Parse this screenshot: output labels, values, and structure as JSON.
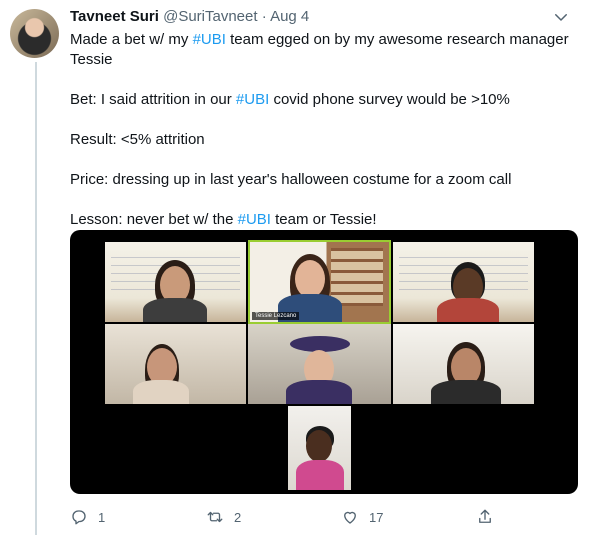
{
  "tweet": {
    "author_name": "Tavneet Suri",
    "handle": "@SuriTavneet",
    "separator": "·",
    "date": "Aug 4",
    "lines": {
      "l1_pre": "Made a bet w/ my ",
      "l1_tag": "#UBI",
      "l1_post": " team egged on by my awesome research manager Tessie",
      "l2_pre": "Bet: I said attrition in our ",
      "l2_tag": "#UBI",
      "l2_post": " covid phone survey would be >10%",
      "l3": "Result: <5% attrition",
      "l4": "Price: dressing up in last year's halloween costume for a zoom call",
      "l5_pre": "Lesson: never bet w/ the ",
      "l5_tag": "#UBI",
      "l5_post": " team or Tessie!"
    },
    "media": {
      "nametag": "Tessie Lezcano"
    },
    "actions": {
      "reply_count": "1",
      "retweet_count": "2",
      "like_count": "17"
    }
  },
  "colors": {
    "link": "#1d9bf0",
    "muted": "#536471",
    "active_speaker_border": "#9acd32"
  },
  "icons": [
    "chevron-down-icon",
    "reply-icon",
    "retweet-icon",
    "like-icon",
    "share-icon"
  ]
}
